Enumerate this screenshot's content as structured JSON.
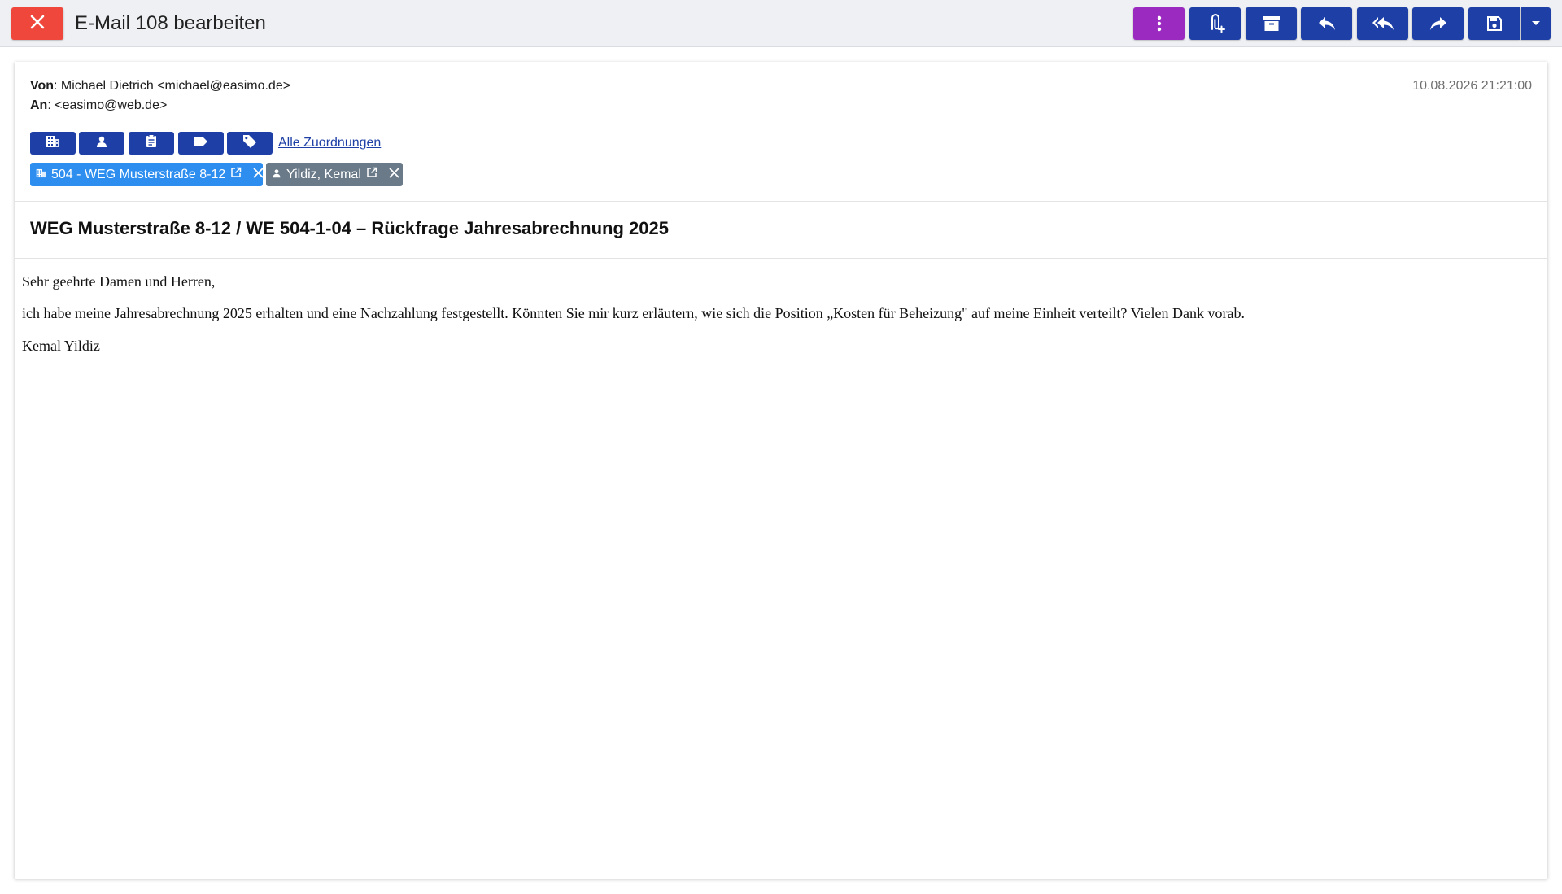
{
  "window": {
    "title": "E-Mail 108 bearbeiten"
  },
  "toolbar": {
    "icons": [
      "close-icon",
      "more-vertical-icon",
      "attach-add-icon",
      "archive-icon",
      "reply-icon",
      "reply-all-icon",
      "forward-icon",
      "save-icon",
      "dropdown-icon"
    ],
    "colors": {
      "close": "#f0473d",
      "more": "#9b2bc0",
      "action": "#1e40a6"
    }
  },
  "email": {
    "from_label": "Von",
    "from_value": ": Michael Dietrich <michael@easimo.de>",
    "to_label": "An",
    "to_value": ": <easimo@web.de>",
    "date": "10.08.2026 21:21:00",
    "assign_icons": [
      "building-icon",
      "person-icon",
      "clipboard-icon",
      "label-icon",
      "tag-icon"
    ],
    "all_assignments_link": "Alle Zuordnungen",
    "chips": [
      {
        "label": "504 - WEG Musterstraße 8-12",
        "icon": "building-icon",
        "color": "#2d8ef0"
      },
      {
        "label": "Yildiz, Kemal",
        "icon": "person-icon",
        "color": "#6a7a89"
      }
    ],
    "subject": "WEG Musterstraße 8-12 / WE 504-1-04 – Rückfrage Jahresabrechnung 2025",
    "body": [
      "Sehr geehrte Damen und Herren,",
      "ich habe meine Jahresabrechnung 2025 erhalten und eine Nachzahlung festgestellt. Könnten Sie mir kurz erläutern, wie sich die Position „Kosten für Beheizung\" auf meine Einheit verteilt? Vielen Dank vorab.",
      "Kemal Yildiz"
    ]
  }
}
